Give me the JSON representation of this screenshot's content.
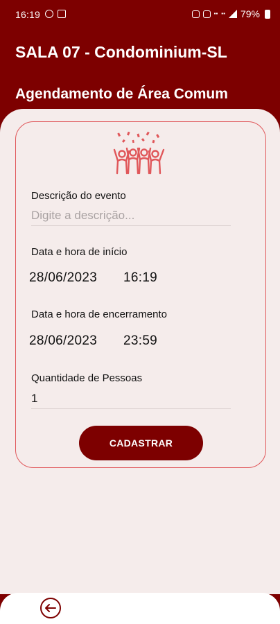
{
  "status_bar": {
    "time": "16:19",
    "battery": "79%"
  },
  "header": {
    "app_title": "SALA 07 - Condominium-SL",
    "page_title": "Agendamento de Área Comum"
  },
  "form": {
    "description": {
      "label": "Descrição do evento",
      "placeholder": "Digite a descrição...",
      "value": ""
    },
    "start": {
      "label": "Data e hora de início",
      "date": "28/06/2023",
      "time": "16:19"
    },
    "end": {
      "label": "Data e hora de encerramento",
      "date": "28/06/2023",
      "time": "23:59"
    },
    "people": {
      "label": "Quantidade de Pessoas",
      "value": "1"
    },
    "submit_label": "CADASTRAR"
  },
  "icons": {
    "event": "party-people-icon",
    "back": "back-arrow-icon"
  },
  "colors": {
    "primary": "#7d0000",
    "accent": "#e0575a",
    "background": "#f5eceb"
  }
}
